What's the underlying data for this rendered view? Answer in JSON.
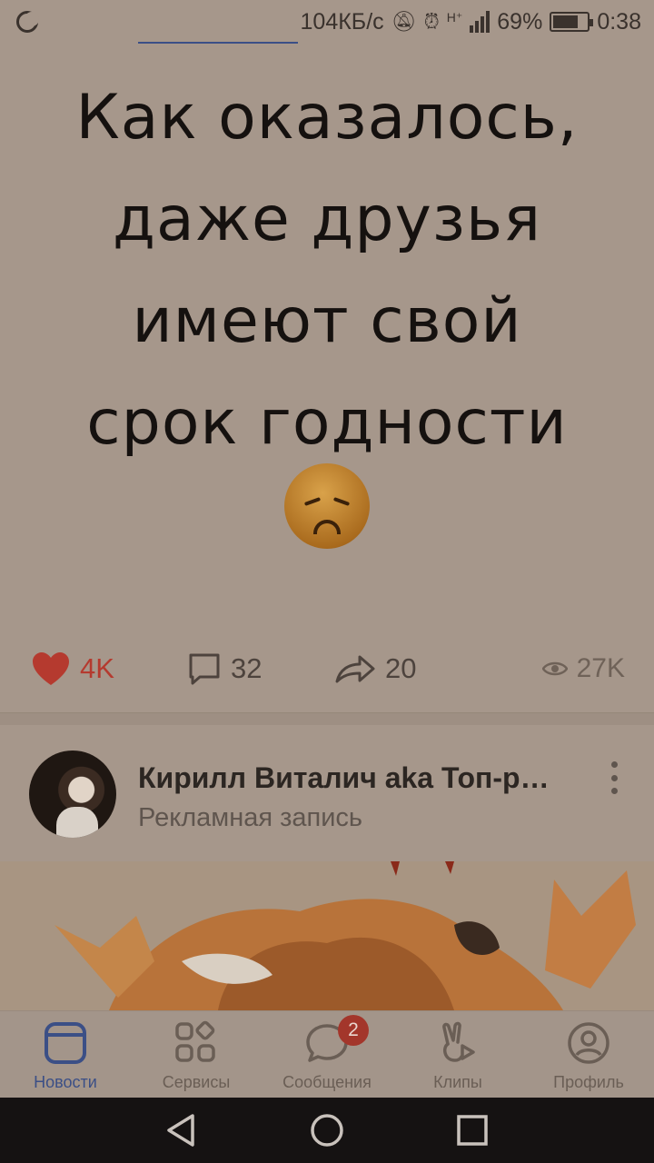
{
  "status_bar": {
    "speed": "104КБ/с",
    "network": "H⁺",
    "battery_percent": "69%",
    "battery_level": 0.69,
    "time": "0:38"
  },
  "post": {
    "meme_lines": [
      "Как оказалось,",
      "даже друзья",
      "имеют свой",
      "срок годности"
    ],
    "emoji": "disappointed-face",
    "likes": "4K",
    "comments": "32",
    "shares": "20",
    "views": "27K"
  },
  "ad_post": {
    "author": "Кирилл Виталич aka Топ-р…",
    "subtitle": "Рекламная запись"
  },
  "tab_bar": {
    "tabs": [
      {
        "label": "Новости",
        "icon": "news-icon",
        "active": true
      },
      {
        "label": "Сервисы",
        "icon": "services-icon"
      },
      {
        "label": "Сообщения",
        "icon": "messages-icon",
        "badge": "2"
      },
      {
        "label": "Клипы",
        "icon": "clips-icon"
      },
      {
        "label": "Профиль",
        "icon": "profile-icon"
      }
    ]
  },
  "colors": {
    "accent": "#3b4f86",
    "like": "#b53a2f",
    "badge": "#a3362b",
    "background": "#a6978b"
  }
}
